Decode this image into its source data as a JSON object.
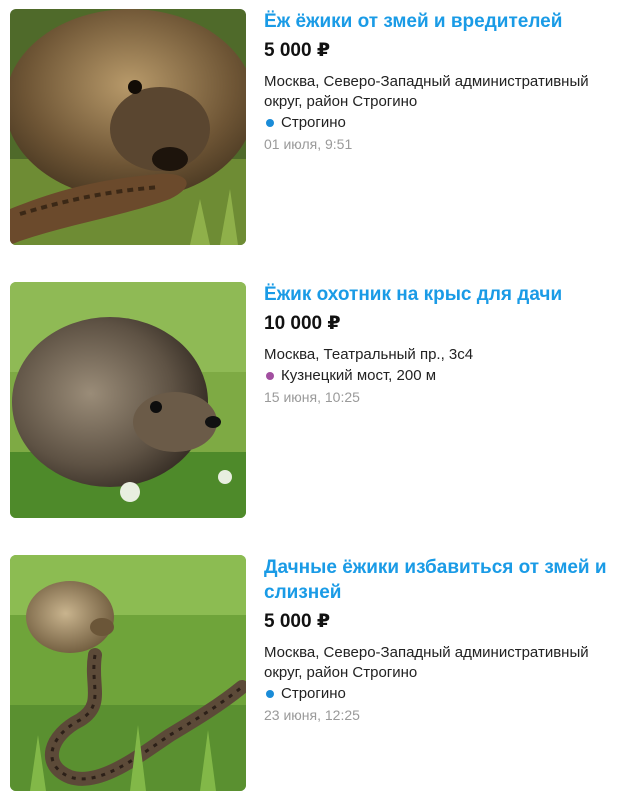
{
  "listings": [
    {
      "title": "Ёж ёжики от змей и вредителей",
      "price": "5 000 ₽",
      "address": "Москва, Северо-Западный административный округ, район Строгино",
      "metro": "Строгино",
      "metro_color": "#1a8cd8",
      "date": "01 июля, 9:51",
      "image": "hedgehog-with-snake-photo"
    },
    {
      "title": "Ёжик охотник на крыс для дачи",
      "price": "10 000 ₽",
      "address": "Москва, Театральный пр., 3с4",
      "metro": "Кузнецкий мост, 200 м",
      "metro_color": "#a24fa0",
      "date": "15 июня, 10:25",
      "image": "hedgehog-on-grass-photo"
    },
    {
      "title": "Дачные ёжики избавиться от змей и слизней",
      "price": "5 000 ₽",
      "address": "Москва, Северо-Западный административный округ, район Строгино",
      "metro": "Строгино",
      "metro_color": "#1a8cd8",
      "date": "23 июня, 12:25",
      "image": "hedgehog-and-snake-in-grass-photo"
    }
  ]
}
